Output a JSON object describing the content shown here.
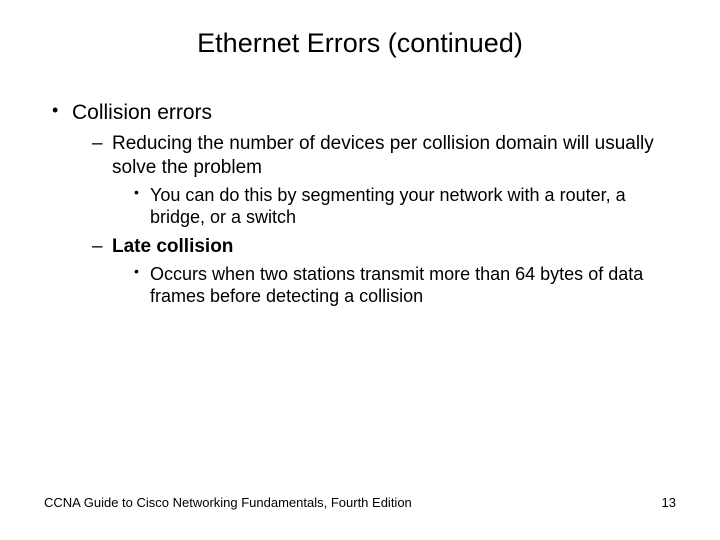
{
  "title": "Ethernet Errors (continued)",
  "bullets": {
    "l1_0": "Collision errors",
    "l2_0": "Reducing the number of devices per collision domain will usually solve the problem",
    "l3_0": "You can do this by segmenting your network with a router, a bridge, or a switch",
    "l2_1": "Late collision",
    "l3_1": "Occurs when two stations transmit more than 64 bytes of data frames before detecting a collision"
  },
  "footer": {
    "source": "CCNA Guide to Cisco Networking Fundamentals, Fourth Edition",
    "page": "13"
  }
}
